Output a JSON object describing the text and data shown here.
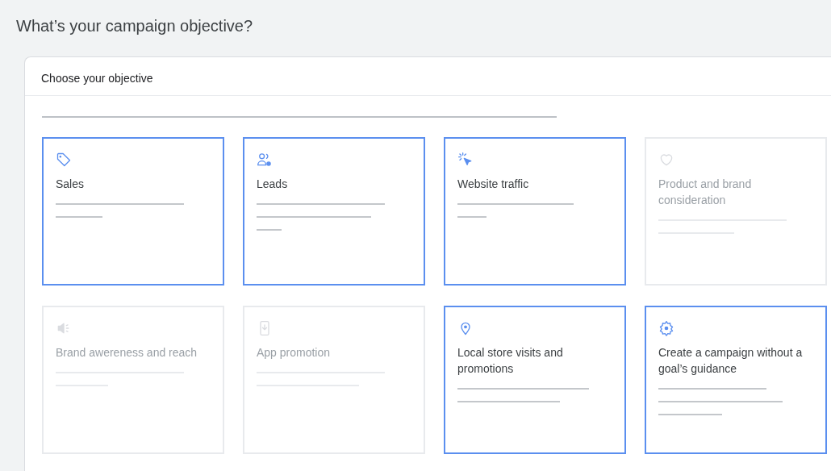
{
  "page": {
    "title": "What’s your campaign objective?"
  },
  "panel": {
    "title": "Choose your objective"
  },
  "objectives": [
    {
      "label": "Sales",
      "kind": "tag",
      "selected": true,
      "disabled": false
    },
    {
      "label": "Leads",
      "kind": "people",
      "selected": true,
      "disabled": false
    },
    {
      "label": "Website traffic",
      "kind": "cursor",
      "selected": true,
      "disabled": false
    },
    {
      "label": "Product and brand consideration",
      "kind": "heart",
      "selected": false,
      "disabled": true
    },
    {
      "label": "Brand awereness and reach",
      "kind": "speaker",
      "selected": false,
      "disabled": true
    },
    {
      "label": "App promotion",
      "kind": "phone",
      "selected": false,
      "disabled": true
    },
    {
      "label": "Local store visits and promotions",
      "kind": "pin",
      "selected": true,
      "disabled": false
    },
    {
      "label": "Create a campaign without a goal’s guidance",
      "kind": "gear",
      "selected": true,
      "disabled": false
    }
  ]
}
